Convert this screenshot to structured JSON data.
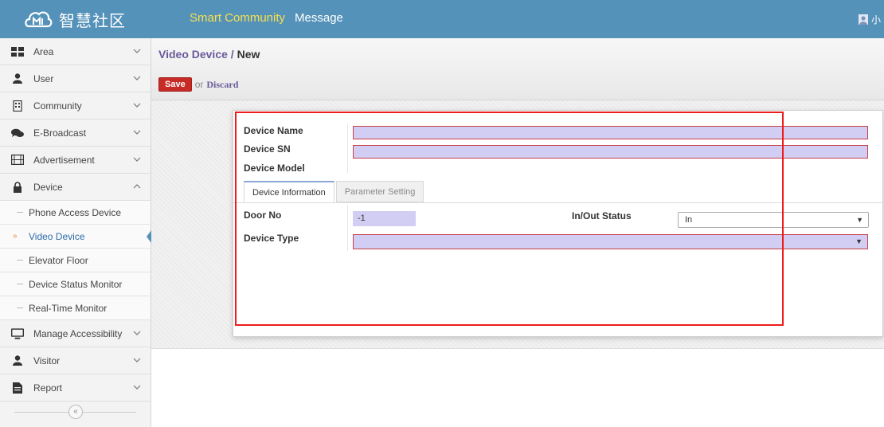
{
  "topbar": {
    "brand_text": "智慧社区",
    "nav": [
      "Smart Community",
      "Message"
    ],
    "user_text": "小"
  },
  "sidebar": {
    "items": [
      {
        "label": "Area",
        "icon": "grid-icon",
        "chevron": "down"
      },
      {
        "label": "User",
        "icon": "user-icon",
        "chevron": "down"
      },
      {
        "label": "Community",
        "icon": "building-icon",
        "chevron": "down"
      },
      {
        "label": "E-Broadcast",
        "icon": "comments-icon",
        "chevron": "down"
      },
      {
        "label": "Advertisement",
        "icon": "film-icon",
        "chevron": "down"
      },
      {
        "label": "Device",
        "icon": "lock-icon",
        "chevron": "up"
      }
    ],
    "sub_items": [
      {
        "label": "Phone Access Device"
      },
      {
        "label": "Video Device",
        "active": true
      },
      {
        "label": "Elevator Floor"
      },
      {
        "label": "Device Status Monitor"
      },
      {
        "label": "Real-Time Monitor"
      }
    ],
    "items_after": [
      {
        "label": "Manage Accessibility",
        "icon": "monitor-icon",
        "chevron": "down"
      },
      {
        "label": "Visitor",
        "icon": "user-icon",
        "chevron": "down"
      },
      {
        "label": "Report",
        "icon": "document-icon",
        "chevron": "down"
      }
    ],
    "collapse_glyph": "«"
  },
  "breadcrumb": {
    "parent": "Video Device",
    "separator": " / ",
    "current": "New"
  },
  "actions": {
    "save_label": "Save",
    "or_text": "or",
    "discard_label": "Discard"
  },
  "form": {
    "device_name_label": "Device Name",
    "device_sn_label": "Device SN",
    "device_model_label": "Device Model",
    "tabs": [
      "Device Information",
      "Parameter Setting"
    ],
    "door_no_label": "Door No",
    "door_no_value": "-1",
    "in_out_label": "In/Out Status",
    "in_out_value": "In",
    "device_type_label": "Device Type"
  },
  "colors": {
    "topbar": "#5592b9",
    "save": "#c72b26",
    "required_field": "#d2cdf2",
    "highlight": "#ee1c1c"
  }
}
